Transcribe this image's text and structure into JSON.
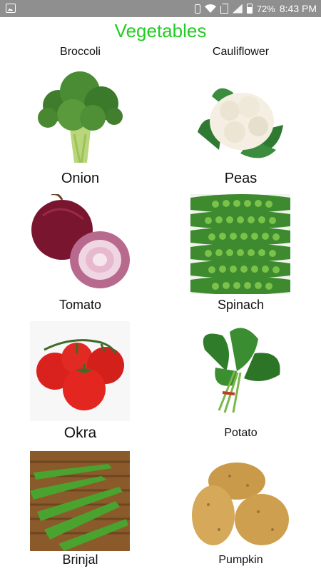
{
  "status_bar": {
    "battery": "72%",
    "time": "8:43 PM",
    "icons": [
      "gallery-icon",
      "vibrate-icon",
      "wifi-icon",
      "no-sim-icon",
      "signal-icon",
      "battery-icon"
    ]
  },
  "title": "Vegetables",
  "items": [
    {
      "label": "Broccoli"
    },
    {
      "label": "Cauliflower"
    },
    {
      "label": "Onion"
    },
    {
      "label": "Peas"
    },
    {
      "label": "Tomato"
    },
    {
      "label": "Spinach"
    },
    {
      "label": "Okra"
    },
    {
      "label": "Potato"
    },
    {
      "label": "Brinjal"
    },
    {
      "label": "Pumpkin"
    }
  ],
  "colors": {
    "title": "#22cc22",
    "status_bar": "#8f8f8f"
  }
}
